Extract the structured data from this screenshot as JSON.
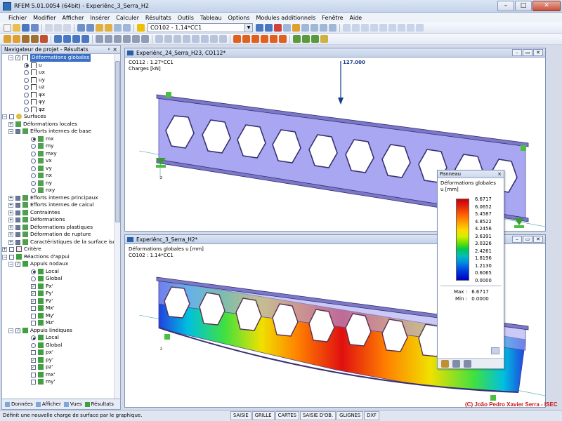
{
  "app": {
    "title": "RFEM 5.01.0054 (64bit) - Experiênc_3_Serra_H2"
  },
  "menu": [
    "Fichier",
    "Modifier",
    "Afficher",
    "Insérer",
    "Calculer",
    "Résultats",
    "Outils",
    "Tableau",
    "Options",
    "Modules additionnels",
    "Fenêtre",
    "Aide"
  ],
  "toolbar": {
    "loadcase": "CO102 - 1.14*CC1"
  },
  "navigator": {
    "title": "Navigateur de projet - Résultats",
    "items": [
      "Déformations globales",
      "u",
      "ux",
      "uy",
      "uz",
      "φx",
      "φy",
      "φz",
      "Surfaces",
      "Déformations locales",
      "Efforts internes de base",
      "mx",
      "my",
      "mxy",
      "vx",
      "vy",
      "nx",
      "ny",
      "nxy",
      "Efforts internes principaux",
      "Efforts internes de calcul",
      "Contraintes",
      "Déformations",
      "Déformations plastiques",
      "Déformation de rupture",
      "Caractéristiques de la surface isotr",
      "Critère",
      "Réactions d'appui",
      "Appuis nodaux",
      "Local",
      "Global",
      "Px'",
      "Py'",
      "Pz'",
      "Mx'",
      "My'",
      "Mz'",
      "Appuis linéiques",
      "Local",
      "Global",
      "px'",
      "py'",
      "pz'",
      "mx'",
      "my'"
    ],
    "tabs": [
      "Données",
      "Afficher",
      "Vues",
      "Résultats"
    ]
  },
  "window1": {
    "title": "Experiênc_24_Serra_H23, CO112*",
    "info1": "CO112 : 1.27*CC1",
    "info2": "Charges [kN]",
    "load": "127.000"
  },
  "window2": {
    "title": "Experiênc_3_Serra_H2*",
    "info1": "Déformations globales u [mm]",
    "info2": "CO102 : 1.14*CC1"
  },
  "panel": {
    "title": "Panneau",
    "label1": "Déformations globales",
    "label2": "u [mm]",
    "values": [
      "6.6717",
      "6.0652",
      "5.4587",
      "4.8522",
      "4.2456",
      "3.6391",
      "3.0326",
      "2.4261",
      "1.8196",
      "1.2130",
      "0.6065",
      "0.0000"
    ],
    "max_label": "Max :",
    "max": "6.6717",
    "min_label": "Min :",
    "min": "0.0000"
  },
  "status": {
    "message": "Définit une nouvelle charge de surface par le graphique.",
    "modes": [
      "SAISIE",
      "GRILLE",
      "CARTES",
      "SAISIE D'OB.",
      "GLIGNES",
      "DXF"
    ]
  },
  "copyright": "(C) João Pedro Xavier Serra - ISEC"
}
